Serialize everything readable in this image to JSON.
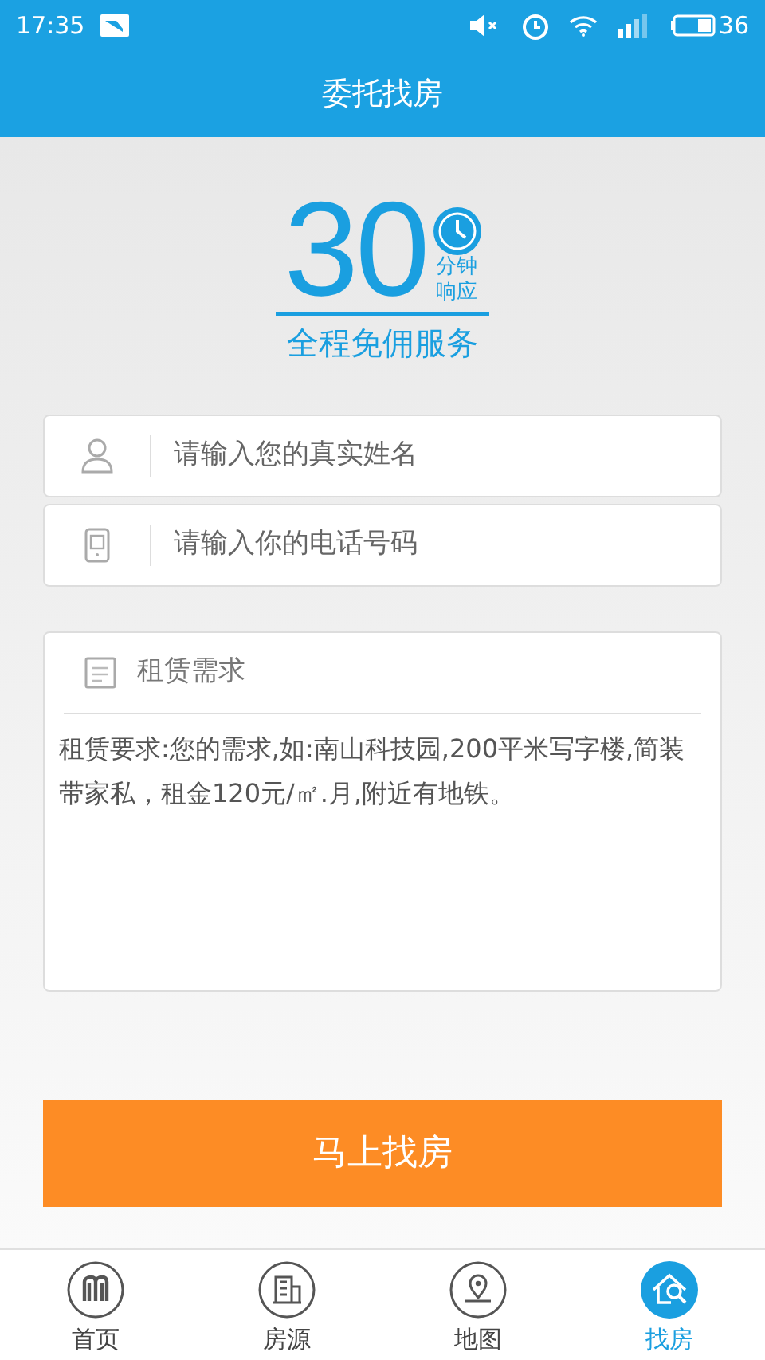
{
  "status_bar": {
    "time": "17:35",
    "battery": "36"
  },
  "header": {
    "title": "委托找房"
  },
  "promo": {
    "number": "30",
    "badge_line_1": "分钟",
    "badge_line_2": "响应",
    "tagline": "全程免佣服务"
  },
  "fields": [
    {
      "kind": "person",
      "placeholder": "请输入您的真实姓名"
    },
    {
      "kind": "phone",
      "placeholder": "请输入你的电话号码"
    }
  ],
  "requirements": {
    "label": "租赁需求",
    "placeholder": "租赁要求:您的需求,如:南山科技园,200平米写字楼,简装带家私，租金120元/㎡.月,附近有地铁。"
  },
  "submit": {
    "label": "马上找房"
  },
  "tabs": [
    {
      "kind": "home",
      "label": "首页",
      "selected": false
    },
    {
      "kind": "building",
      "label": "房源",
      "selected": false
    },
    {
      "kind": "map",
      "label": "地图",
      "selected": false
    },
    {
      "kind": "search-house",
      "label": "找房",
      "selected": true
    }
  ]
}
